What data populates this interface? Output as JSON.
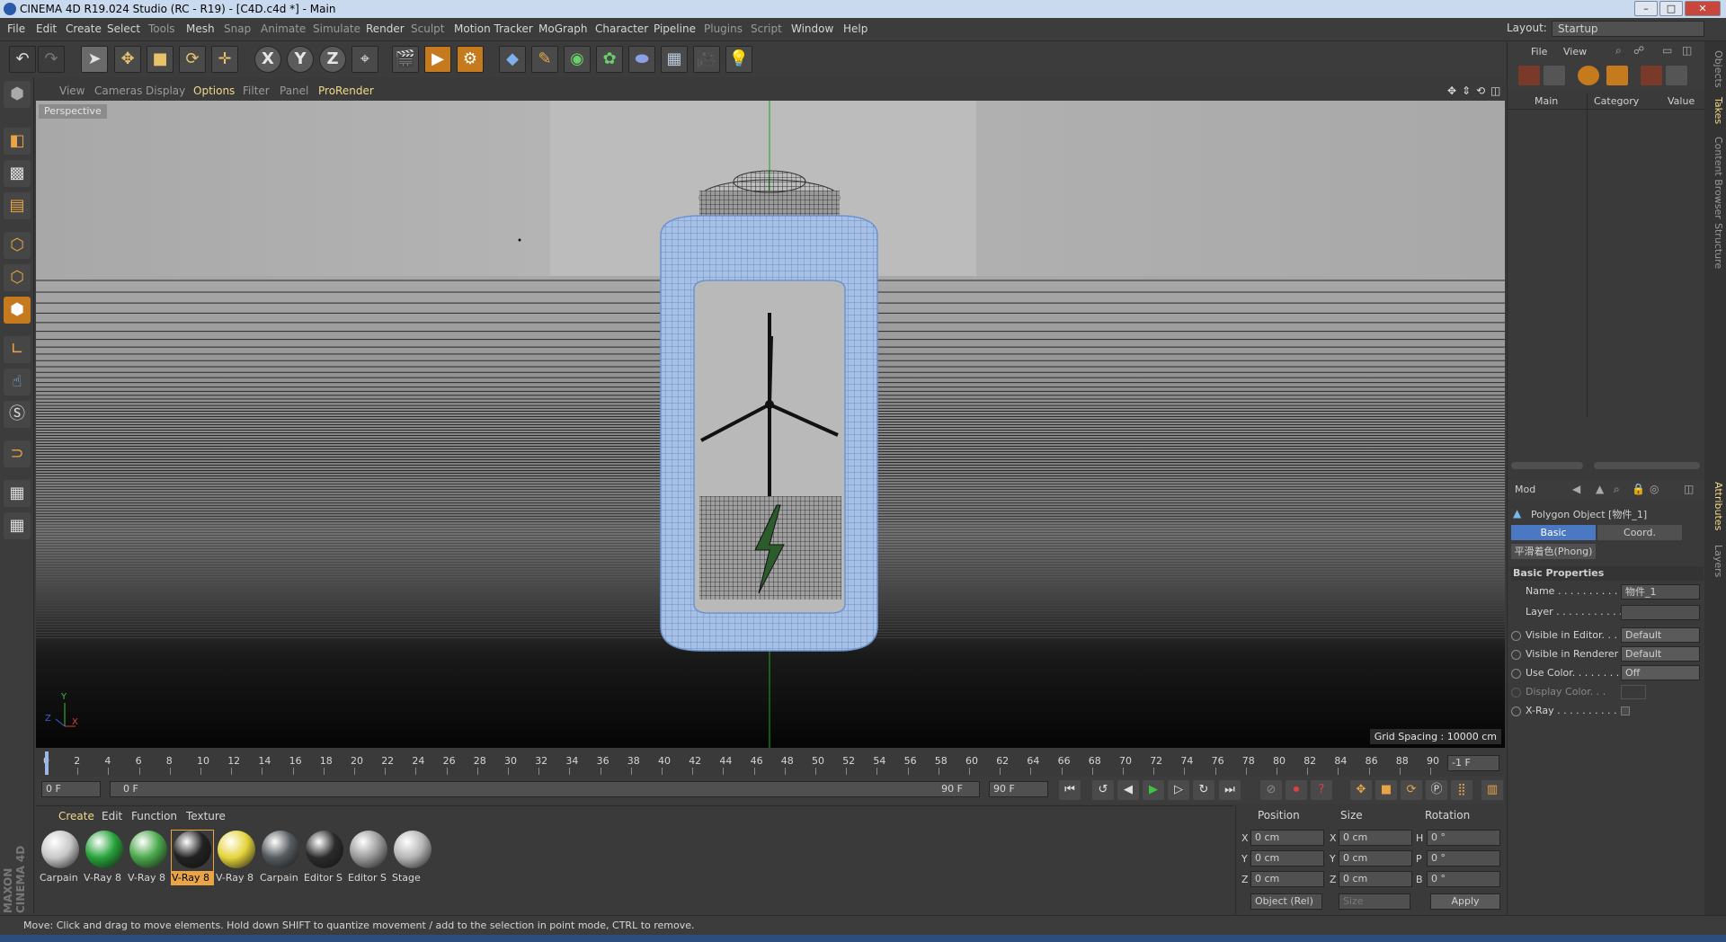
{
  "window": {
    "title": "CINEMA 4D R19.024 Studio (RC - R19) - [C4D.c4d *] - Main"
  },
  "menubar": {
    "items": [
      "File",
      "Edit",
      "Create",
      "Select",
      "Tools",
      "Mesh",
      "Snap",
      "Animate",
      "Simulate",
      "Render",
      "Sculpt",
      "Motion Tracker",
      "MoGraph",
      "Character",
      "Pipeline",
      "Plugins",
      "Script",
      "Window",
      "Help"
    ],
    "layout_label": "Layout:",
    "layout_value": "Startup"
  },
  "viewport": {
    "menu": [
      "View",
      "Cameras",
      "Display",
      "Options",
      "Filter",
      "Panel",
      "ProRender"
    ],
    "camera_label": "Perspective",
    "grid_spacing": "Grid Spacing : 10000 cm",
    "axis": {
      "y": "Y",
      "z": "Z",
      "x": "X"
    }
  },
  "timeline": {
    "ticks": [
      "0",
      "2",
      "4",
      "6",
      "8",
      "10",
      "12",
      "14",
      "16",
      "18",
      "20",
      "22",
      "24",
      "26",
      "28",
      "30",
      "32",
      "34",
      "36",
      "38",
      "40",
      "42",
      "44",
      "46",
      "48",
      "50",
      "52",
      "54",
      "56",
      "58",
      "60",
      "62",
      "64",
      "66",
      "68",
      "70",
      "72",
      "74",
      "76",
      "78",
      "80",
      "82",
      "84",
      "86",
      "88",
      "90"
    ],
    "end_marker": "-1 F",
    "current_frame": "0 F",
    "range_start": "0 F",
    "range_end": "90 F",
    "end_frame": "90 F"
  },
  "material_manager": {
    "menu": [
      "Create",
      "Edit",
      "Function",
      "Texture"
    ],
    "materials": [
      {
        "label": "Carpain",
        "color": "#c7c7c7"
      },
      {
        "label": "V-Ray 8",
        "color": "#27a33a"
      },
      {
        "label": "V-Ray 8",
        "color": "#4aa84a"
      },
      {
        "label": "V-Ray 8",
        "color": "#222222",
        "selected": true
      },
      {
        "label": "V-Ray 8",
        "color": "#e5d43a"
      },
      {
        "label": "Carpain",
        "color": "#555a5e"
      },
      {
        "label": "Editor S",
        "color": "#2b2b2b"
      },
      {
        "label": "Editor S",
        "color": "#9a9a9a"
      },
      {
        "label": "Stage",
        "color": "#b5b5b5"
      }
    ]
  },
  "coordinates": {
    "headers": [
      "Position",
      "Size",
      "Rotation"
    ],
    "rows": [
      {
        "pos_axis": "X",
        "pos": "0 cm",
        "size_axis": "X",
        "size": "0 cm",
        "rot_axis": "H",
        "rot": "0 °"
      },
      {
        "pos_axis": "Y",
        "pos": "0 cm",
        "size_axis": "Y",
        "size": "0 cm",
        "rot_axis": "P",
        "rot": "0 °"
      },
      {
        "pos_axis": "Z",
        "pos": "0 cm",
        "size_axis": "Z",
        "size": "0 cm",
        "rot_axis": "B",
        "rot": "0 °"
      }
    ],
    "mode": "Object (Rel)",
    "size_mode": "Size",
    "apply": "Apply"
  },
  "objects_panel": {
    "menu": [
      "File",
      "View"
    ],
    "columns": [
      "Main",
      "Category",
      "Value"
    ]
  },
  "attributes": {
    "mode": "Mod",
    "object_title": "Polygon Object [物件_1]",
    "tabs": [
      "Basic",
      "Coord."
    ],
    "phong_tab": "平滑着色(Phong)",
    "section": "Basic Properties",
    "rows": [
      {
        "label": "Name . . . . . . . . . . .",
        "value": "物件_1"
      },
      {
        "label": "Layer . . . . . . . . . . .",
        "value": ""
      },
      {
        "label": "Visible in Editor. . .",
        "value": "Default"
      },
      {
        "label": "Visible in Renderer",
        "value": "Default"
      },
      {
        "label": "Use Color. . . . . . . .",
        "value": "Off"
      },
      {
        "label": "Display Color. . .",
        "value": ""
      },
      {
        "label": "X-Ray . . . . . . . . . .",
        "value": ""
      }
    ]
  },
  "side_tabs": [
    "Objects",
    "Takes",
    "Content Browser",
    "Structure",
    "Attributes",
    "Layers"
  ],
  "status": "Move: Click and drag to move elements. Hold down SHIFT to quantize movement / add to the selection in point mode, CTRL to remove.",
  "brand": "MAXON CINEMA 4D",
  "colors": {
    "accent": "#f1d98a",
    "selection": "#4a78c2",
    "mesh_blue": "#8aaee0"
  }
}
